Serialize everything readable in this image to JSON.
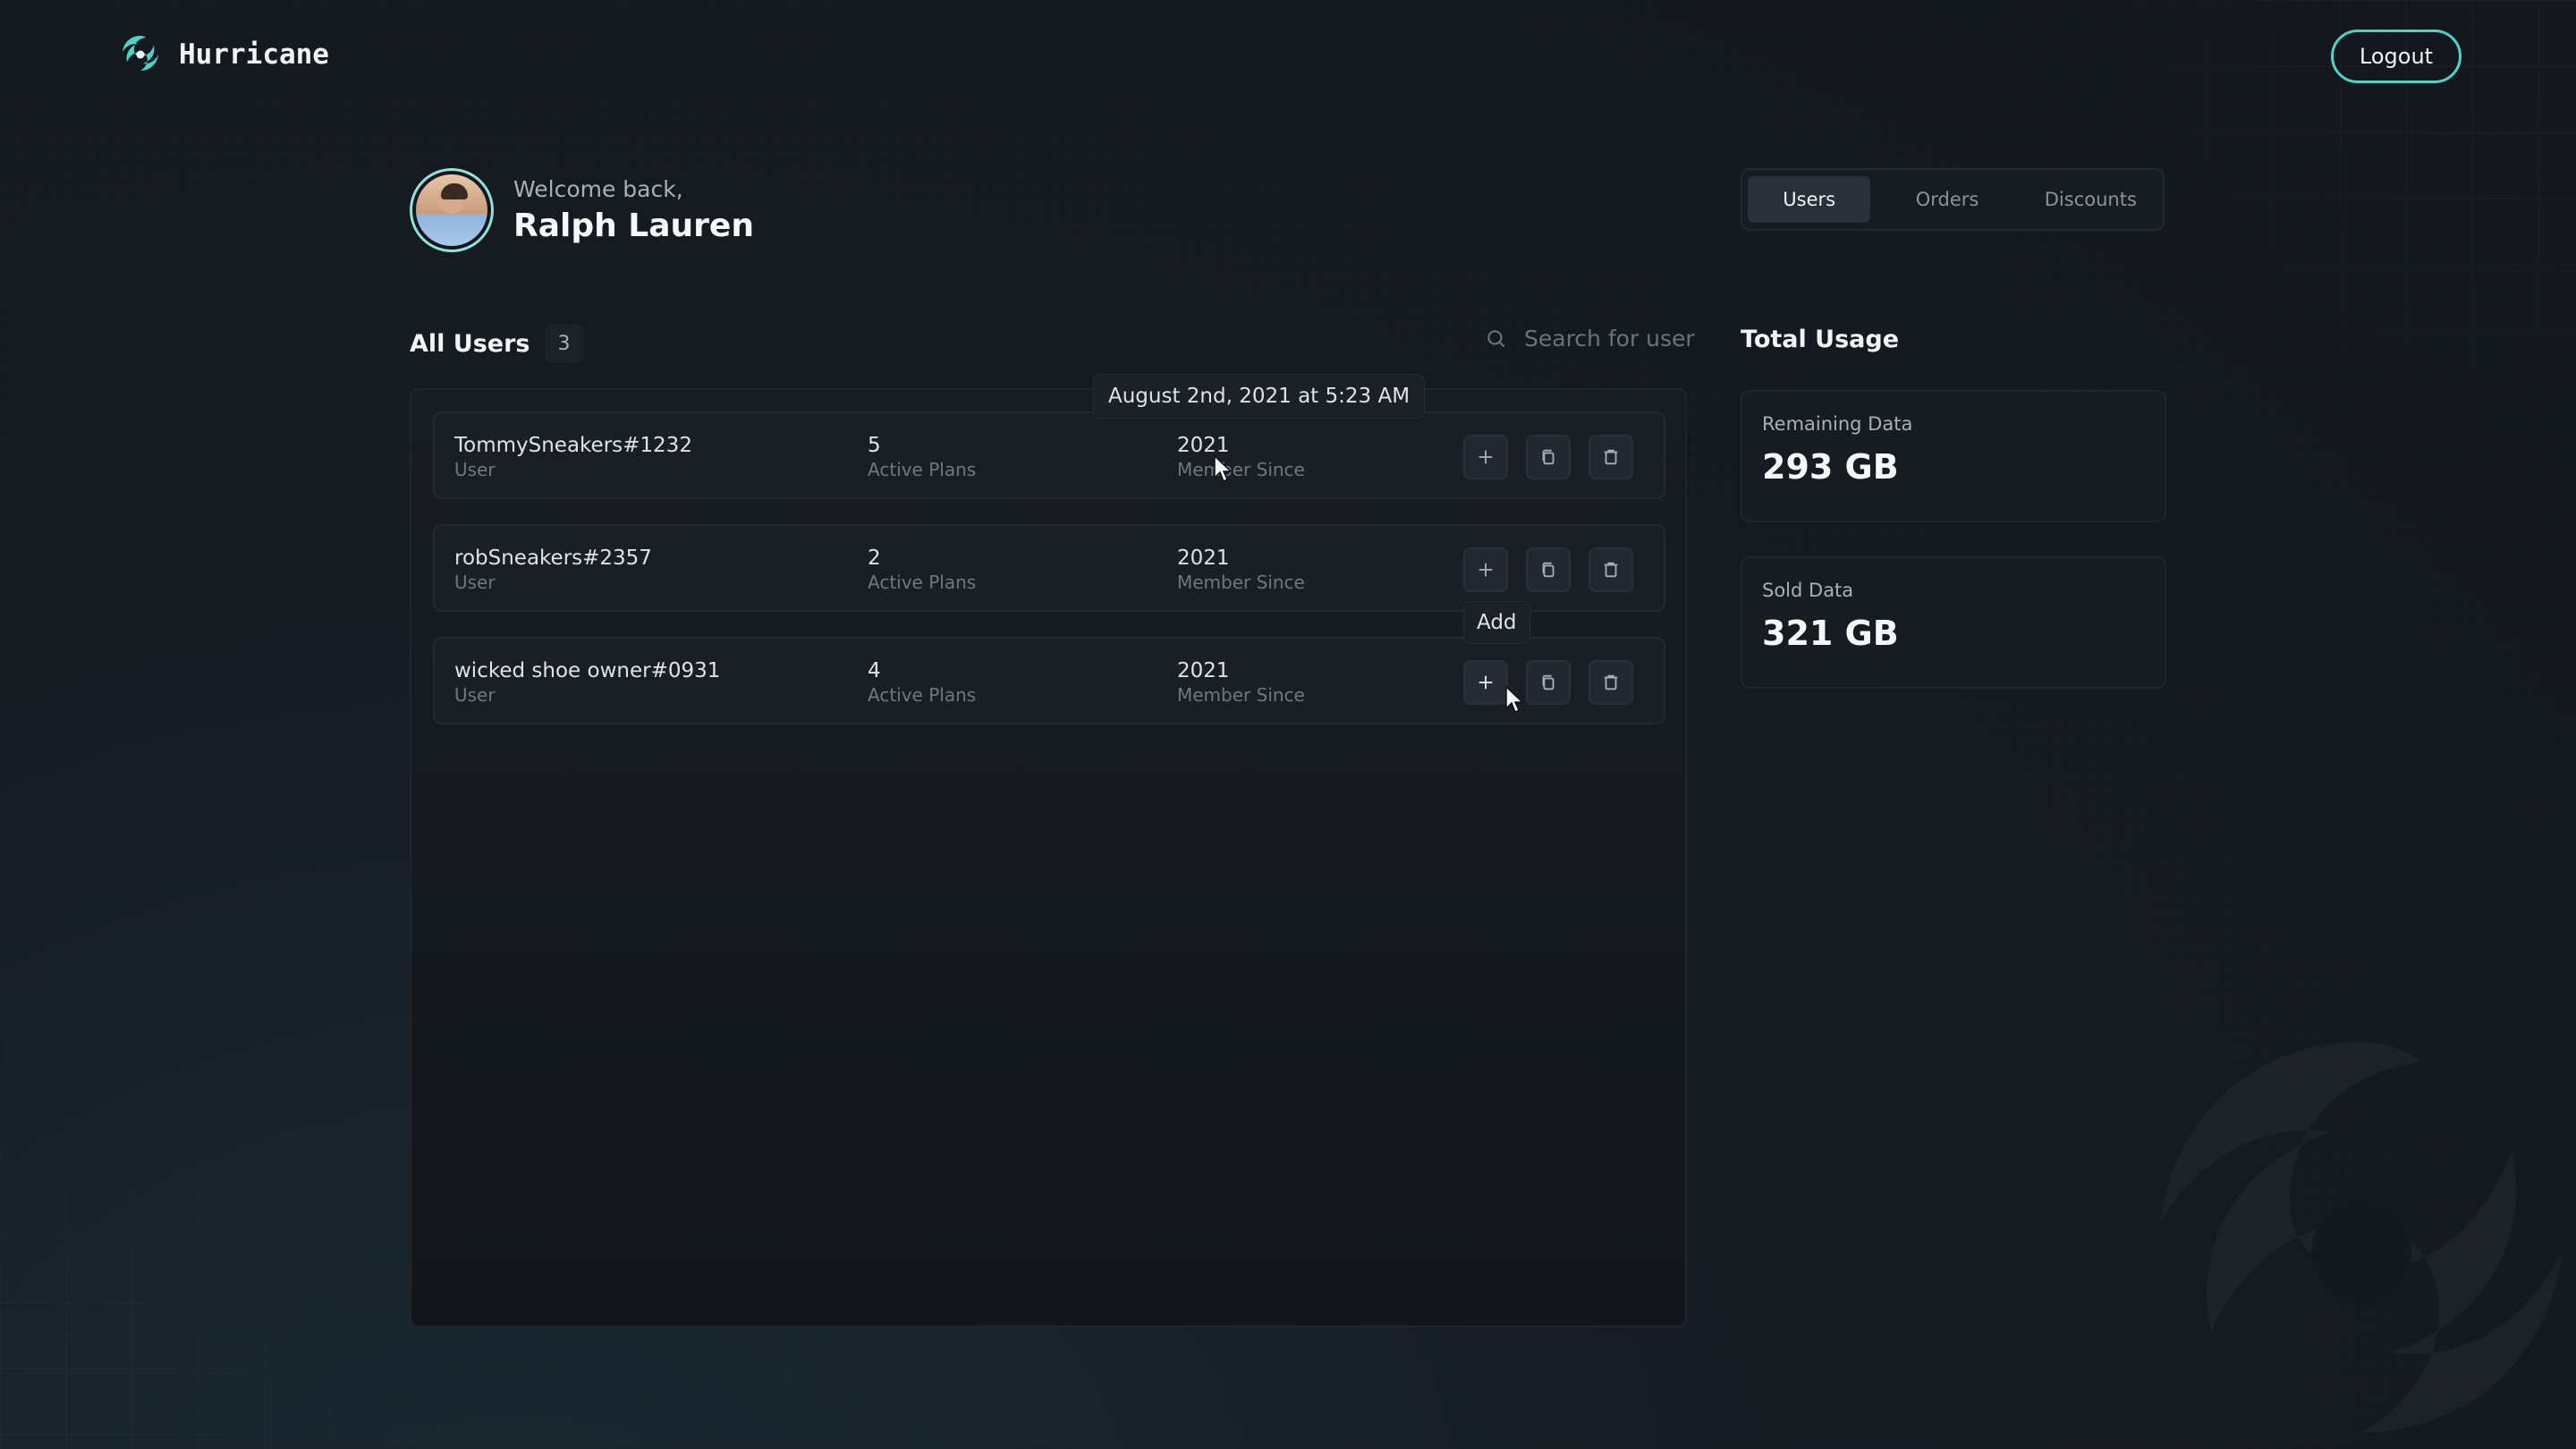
{
  "brand": {
    "name": "Hurricane",
    "icon": "hurricane-logo-icon",
    "accent_color": "#4fd1c5"
  },
  "header": {
    "logout_label": "Logout"
  },
  "welcome": {
    "greeting": "Welcome back,",
    "name": "Ralph Lauren"
  },
  "tabs": [
    {
      "label": "Users",
      "active": true
    },
    {
      "label": "Orders",
      "active": false
    },
    {
      "label": "Discounts",
      "active": false
    }
  ],
  "users_section": {
    "title": "All Users",
    "count": "3",
    "search_placeholder": "Search for user",
    "rows": [
      {
        "name": "TommySneakers#1232",
        "role": "User",
        "plans": "5",
        "plans_label": "Active Plans",
        "since": "2021",
        "since_label": "Member Since"
      },
      {
        "name": "robSneakers#2357",
        "role": "User",
        "plans": "2",
        "plans_label": "Active Plans",
        "since": "2021",
        "since_label": "Member Since"
      },
      {
        "name": "wicked shoe owner#0931",
        "role": "User",
        "plans": "4",
        "plans_label": "Active Plans",
        "since": "2021",
        "since_label": "Member Since"
      }
    ],
    "action_icons": [
      "plus-icon",
      "copy-icon",
      "trash-icon"
    ]
  },
  "tooltips": {
    "date": "August 2nd, 2021 at 5:23 AM",
    "add": "Add"
  },
  "usage": {
    "title": "Total Usage",
    "remaining_label": "Remaining Data",
    "remaining_value": "293 GB",
    "sold_label": "Sold Data",
    "sold_value": "321 GB"
  }
}
